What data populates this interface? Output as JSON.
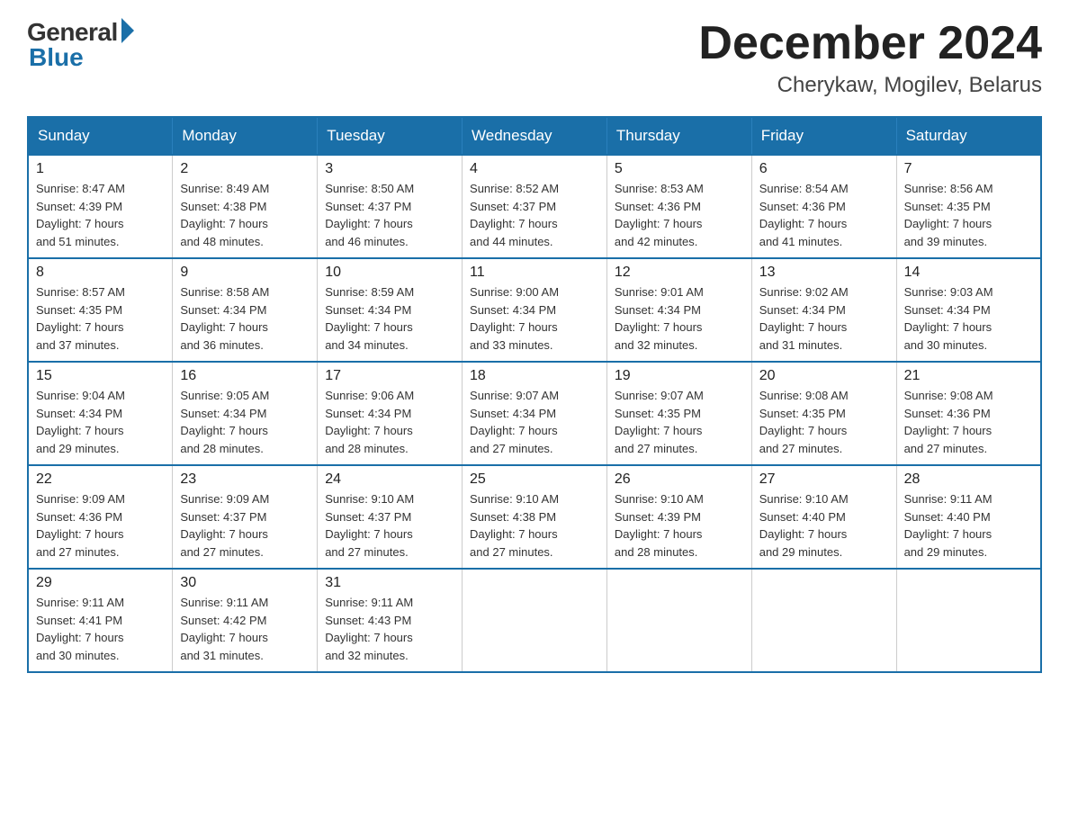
{
  "logo": {
    "general_text": "General",
    "blue_text": "Blue"
  },
  "title": {
    "month_year": "December 2024",
    "location": "Cherykaw, Mogilev, Belarus"
  },
  "weekdays": [
    "Sunday",
    "Monday",
    "Tuesday",
    "Wednesday",
    "Thursday",
    "Friday",
    "Saturday"
  ],
  "weeks": [
    [
      {
        "day": "1",
        "sunrise": "Sunrise: 8:47 AM",
        "sunset": "Sunset: 4:39 PM",
        "daylight": "Daylight: 7 hours",
        "daylight2": "and 51 minutes."
      },
      {
        "day": "2",
        "sunrise": "Sunrise: 8:49 AM",
        "sunset": "Sunset: 4:38 PM",
        "daylight": "Daylight: 7 hours",
        "daylight2": "and 48 minutes."
      },
      {
        "day": "3",
        "sunrise": "Sunrise: 8:50 AM",
        "sunset": "Sunset: 4:37 PM",
        "daylight": "Daylight: 7 hours",
        "daylight2": "and 46 minutes."
      },
      {
        "day": "4",
        "sunrise": "Sunrise: 8:52 AM",
        "sunset": "Sunset: 4:37 PM",
        "daylight": "Daylight: 7 hours",
        "daylight2": "and 44 minutes."
      },
      {
        "day": "5",
        "sunrise": "Sunrise: 8:53 AM",
        "sunset": "Sunset: 4:36 PM",
        "daylight": "Daylight: 7 hours",
        "daylight2": "and 42 minutes."
      },
      {
        "day": "6",
        "sunrise": "Sunrise: 8:54 AM",
        "sunset": "Sunset: 4:36 PM",
        "daylight": "Daylight: 7 hours",
        "daylight2": "and 41 minutes."
      },
      {
        "day": "7",
        "sunrise": "Sunrise: 8:56 AM",
        "sunset": "Sunset: 4:35 PM",
        "daylight": "Daylight: 7 hours",
        "daylight2": "and 39 minutes."
      }
    ],
    [
      {
        "day": "8",
        "sunrise": "Sunrise: 8:57 AM",
        "sunset": "Sunset: 4:35 PM",
        "daylight": "Daylight: 7 hours",
        "daylight2": "and 37 minutes."
      },
      {
        "day": "9",
        "sunrise": "Sunrise: 8:58 AM",
        "sunset": "Sunset: 4:34 PM",
        "daylight": "Daylight: 7 hours",
        "daylight2": "and 36 minutes."
      },
      {
        "day": "10",
        "sunrise": "Sunrise: 8:59 AM",
        "sunset": "Sunset: 4:34 PM",
        "daylight": "Daylight: 7 hours",
        "daylight2": "and 34 minutes."
      },
      {
        "day": "11",
        "sunrise": "Sunrise: 9:00 AM",
        "sunset": "Sunset: 4:34 PM",
        "daylight": "Daylight: 7 hours",
        "daylight2": "and 33 minutes."
      },
      {
        "day": "12",
        "sunrise": "Sunrise: 9:01 AM",
        "sunset": "Sunset: 4:34 PM",
        "daylight": "Daylight: 7 hours",
        "daylight2": "and 32 minutes."
      },
      {
        "day": "13",
        "sunrise": "Sunrise: 9:02 AM",
        "sunset": "Sunset: 4:34 PM",
        "daylight": "Daylight: 7 hours",
        "daylight2": "and 31 minutes."
      },
      {
        "day": "14",
        "sunrise": "Sunrise: 9:03 AM",
        "sunset": "Sunset: 4:34 PM",
        "daylight": "Daylight: 7 hours",
        "daylight2": "and 30 minutes."
      }
    ],
    [
      {
        "day": "15",
        "sunrise": "Sunrise: 9:04 AM",
        "sunset": "Sunset: 4:34 PM",
        "daylight": "Daylight: 7 hours",
        "daylight2": "and 29 minutes."
      },
      {
        "day": "16",
        "sunrise": "Sunrise: 9:05 AM",
        "sunset": "Sunset: 4:34 PM",
        "daylight": "Daylight: 7 hours",
        "daylight2": "and 28 minutes."
      },
      {
        "day": "17",
        "sunrise": "Sunrise: 9:06 AM",
        "sunset": "Sunset: 4:34 PM",
        "daylight": "Daylight: 7 hours",
        "daylight2": "and 28 minutes."
      },
      {
        "day": "18",
        "sunrise": "Sunrise: 9:07 AM",
        "sunset": "Sunset: 4:34 PM",
        "daylight": "Daylight: 7 hours",
        "daylight2": "and 27 minutes."
      },
      {
        "day": "19",
        "sunrise": "Sunrise: 9:07 AM",
        "sunset": "Sunset: 4:35 PM",
        "daylight": "Daylight: 7 hours",
        "daylight2": "and 27 minutes."
      },
      {
        "day": "20",
        "sunrise": "Sunrise: 9:08 AM",
        "sunset": "Sunset: 4:35 PM",
        "daylight": "Daylight: 7 hours",
        "daylight2": "and 27 minutes."
      },
      {
        "day": "21",
        "sunrise": "Sunrise: 9:08 AM",
        "sunset": "Sunset: 4:36 PM",
        "daylight": "Daylight: 7 hours",
        "daylight2": "and 27 minutes."
      }
    ],
    [
      {
        "day": "22",
        "sunrise": "Sunrise: 9:09 AM",
        "sunset": "Sunset: 4:36 PM",
        "daylight": "Daylight: 7 hours",
        "daylight2": "and 27 minutes."
      },
      {
        "day": "23",
        "sunrise": "Sunrise: 9:09 AM",
        "sunset": "Sunset: 4:37 PM",
        "daylight": "Daylight: 7 hours",
        "daylight2": "and 27 minutes."
      },
      {
        "day": "24",
        "sunrise": "Sunrise: 9:10 AM",
        "sunset": "Sunset: 4:37 PM",
        "daylight": "Daylight: 7 hours",
        "daylight2": "and 27 minutes."
      },
      {
        "day": "25",
        "sunrise": "Sunrise: 9:10 AM",
        "sunset": "Sunset: 4:38 PM",
        "daylight": "Daylight: 7 hours",
        "daylight2": "and 27 minutes."
      },
      {
        "day": "26",
        "sunrise": "Sunrise: 9:10 AM",
        "sunset": "Sunset: 4:39 PM",
        "daylight": "Daylight: 7 hours",
        "daylight2": "and 28 minutes."
      },
      {
        "day": "27",
        "sunrise": "Sunrise: 9:10 AM",
        "sunset": "Sunset: 4:40 PM",
        "daylight": "Daylight: 7 hours",
        "daylight2": "and 29 minutes."
      },
      {
        "day": "28",
        "sunrise": "Sunrise: 9:11 AM",
        "sunset": "Sunset: 4:40 PM",
        "daylight": "Daylight: 7 hours",
        "daylight2": "and 29 minutes."
      }
    ],
    [
      {
        "day": "29",
        "sunrise": "Sunrise: 9:11 AM",
        "sunset": "Sunset: 4:41 PM",
        "daylight": "Daylight: 7 hours",
        "daylight2": "and 30 minutes."
      },
      {
        "day": "30",
        "sunrise": "Sunrise: 9:11 AM",
        "sunset": "Sunset: 4:42 PM",
        "daylight": "Daylight: 7 hours",
        "daylight2": "and 31 minutes."
      },
      {
        "day": "31",
        "sunrise": "Sunrise: 9:11 AM",
        "sunset": "Sunset: 4:43 PM",
        "daylight": "Daylight: 7 hours",
        "daylight2": "and 32 minutes."
      },
      null,
      null,
      null,
      null
    ]
  ]
}
